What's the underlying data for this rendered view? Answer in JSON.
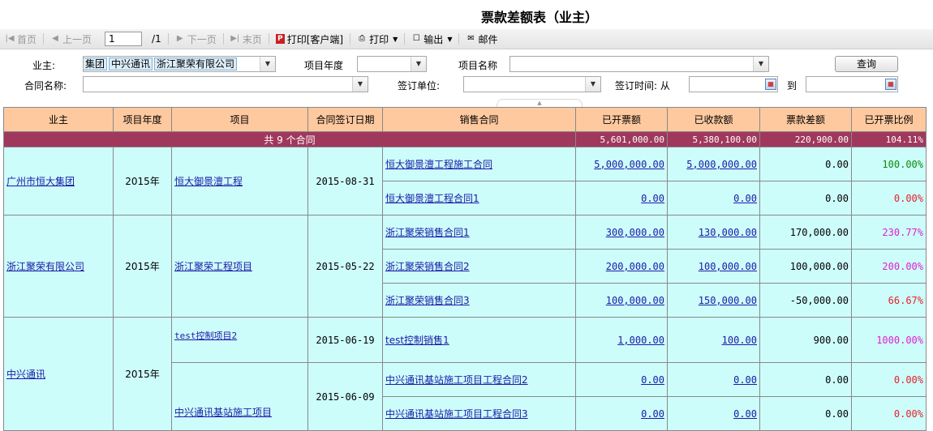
{
  "title": "票款差额表（业主）",
  "toolbar": {
    "first": "首页",
    "prev": "上一页",
    "page_value": "1",
    "page_total": "/1",
    "next": "下一页",
    "last": "末页",
    "print_client": "打印[客户端]",
    "print": "打印",
    "export": "输出",
    "mail": "邮件"
  },
  "filters": {
    "owner_label": "业主:",
    "owner_tags": [
      "集团",
      "中兴通讯",
      "浙江聚荣有限公司"
    ],
    "year_label": "项目年度",
    "project_name_label": "项目名称",
    "query_button": "查询",
    "contract_name_label": "合同名称:",
    "signing_unit_label": "签订单位:",
    "signing_time_label": "签订时间: 从",
    "to_label": "到"
  },
  "table": {
    "headers": [
      "业主",
      "项目年度",
      "项目",
      "合同签订日期",
      "销售合同",
      "已开票额",
      "已收款额",
      "票款差额",
      "已开票比例"
    ],
    "summary": {
      "label": "共 9 个合同",
      "invoiced": "5,601,000.00",
      "received": "5,380,100.00",
      "difference": "220,900.00",
      "ratio": "104.11%"
    },
    "groups": [
      {
        "owner": "广州市恒大集团",
        "year": "2015年",
        "projects": [
          {
            "name": "恒大御景澶工程",
            "date": "2015-08-31",
            "contracts": [
              {
                "name": "恒大御景澶工程施工合同",
                "invoiced": "5,000,000.00",
                "received": "5,000,000.00",
                "difference": "0.00",
                "ratio": "100.00%",
                "ratio_color": "green"
              },
              {
                "name": "恒大御景澶工程合同1",
                "invoiced": "0.00",
                "received": "0.00",
                "difference": "0.00",
                "ratio": "0.00%",
                "ratio_color": "red"
              }
            ]
          }
        ]
      },
      {
        "owner": "浙江聚荣有限公司",
        "year": "2015年",
        "projects": [
          {
            "name": "浙江聚荣工程项目",
            "date": "2015-05-22",
            "contracts": [
              {
                "name": "浙江聚荣销售合同1",
                "invoiced": "300,000.00",
                "received": "130,000.00",
                "difference": "170,000.00",
                "ratio": "230.77%",
                "ratio_color": "pink"
              },
              {
                "name": "浙江聚荣销售合同2",
                "invoiced": "200,000.00",
                "received": "100,000.00",
                "difference": "100,000.00",
                "ratio": "200.00%",
                "ratio_color": "pink"
              },
              {
                "name": "浙江聚荣销售合同3",
                "invoiced": "100,000.00",
                "received": "150,000.00",
                "difference": "-50,000.00",
                "ratio": "66.67%",
                "ratio_color": "red"
              }
            ]
          }
        ]
      },
      {
        "owner": "中兴通讯",
        "year": "2015年",
        "projects": [
          {
            "name": "test控制项目2",
            "date": "2015-06-19",
            "contracts": [
              {
                "name": "test控制销售1",
                "invoiced": "1,000.00",
                "received": "100.00",
                "difference": "900.00",
                "ratio": "1000.00%",
                "ratio_color": "pink"
              }
            ]
          },
          {
            "name": "中兴通讯基站施工项目",
            "date": "2015-06-09",
            "contracts": [
              {
                "name": "中兴通讯基站施工项目工程合同2",
                "invoiced": "0.00",
                "received": "0.00",
                "difference": "0.00",
                "ratio": "0.00%",
                "ratio_color": "red"
              },
              {
                "name": "中兴通讯基站施工项目工程合同3",
                "invoiced": "0.00",
                "received": "0.00",
                "difference": "0.00",
                "ratio": "0.00%",
                "ratio_color": "red"
              }
            ]
          }
        ]
      }
    ]
  },
  "colors": {
    "header_bg": "#ffc9a0",
    "summary_bg": "#a0385e",
    "row_bg": "#cdfdfb",
    "link": "#1a1aa6",
    "pct_green": "#0a8a0a",
    "pct_red": "#e8202a",
    "pct_pink": "#e020c8"
  }
}
